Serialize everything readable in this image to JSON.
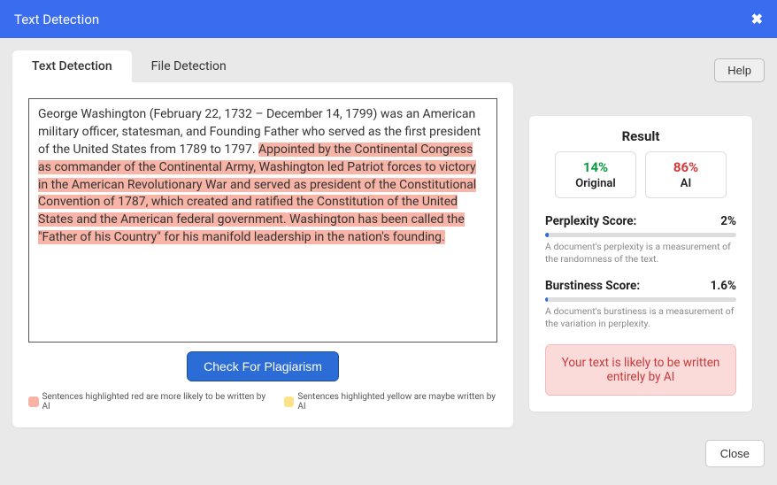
{
  "header": {
    "title": "Text Detection",
    "close_glyph": "✖"
  },
  "tabs": {
    "text": "Text Detection",
    "file": "File Detection"
  },
  "help_label": "Help",
  "text_segments": {
    "s1": "George Washington (February 22, 1732 – December 14, 1799) was an American military officer, statesman, and Founding Father who served as the first president of the United States from 1789 to 1797. ",
    "s2": "Appointed by the Continental Congress as commander of the Continental Army, Washington led Patriot forces to victory in the American Revolutionary War and served as president of the Constitutional Convention of 1787, which created and ratified the Constitution of the United States and the American federal government.",
    "s3": " Washington has been called the \"Father of his Country\" for his manifold leadership in the nation's founding."
  },
  "check_button": "Check For Plagiarism",
  "legend": {
    "red": "Sentences highlighted red are more likely to be written by AI",
    "yellow": "Sentences highlighted yellow are maybe written by AI"
  },
  "result": {
    "title": "Result",
    "original_pct": "14%",
    "original_label": "Original",
    "ai_pct": "86%",
    "ai_label": "AI",
    "perplexity": {
      "label": "Perplexity Score:",
      "value": "2%",
      "fill_pct": 2,
      "desc": "A document's perplexity is a measurement of the randomness of the text."
    },
    "burstiness": {
      "label": "Burstiness Score:",
      "value": "1.6%",
      "fill_pct": 1.6,
      "desc": "A document's burstiness is a measurement of the variation in perplexity."
    },
    "verdict": "Your text is likely to be written entirely by AI"
  },
  "close_label": "Close"
}
